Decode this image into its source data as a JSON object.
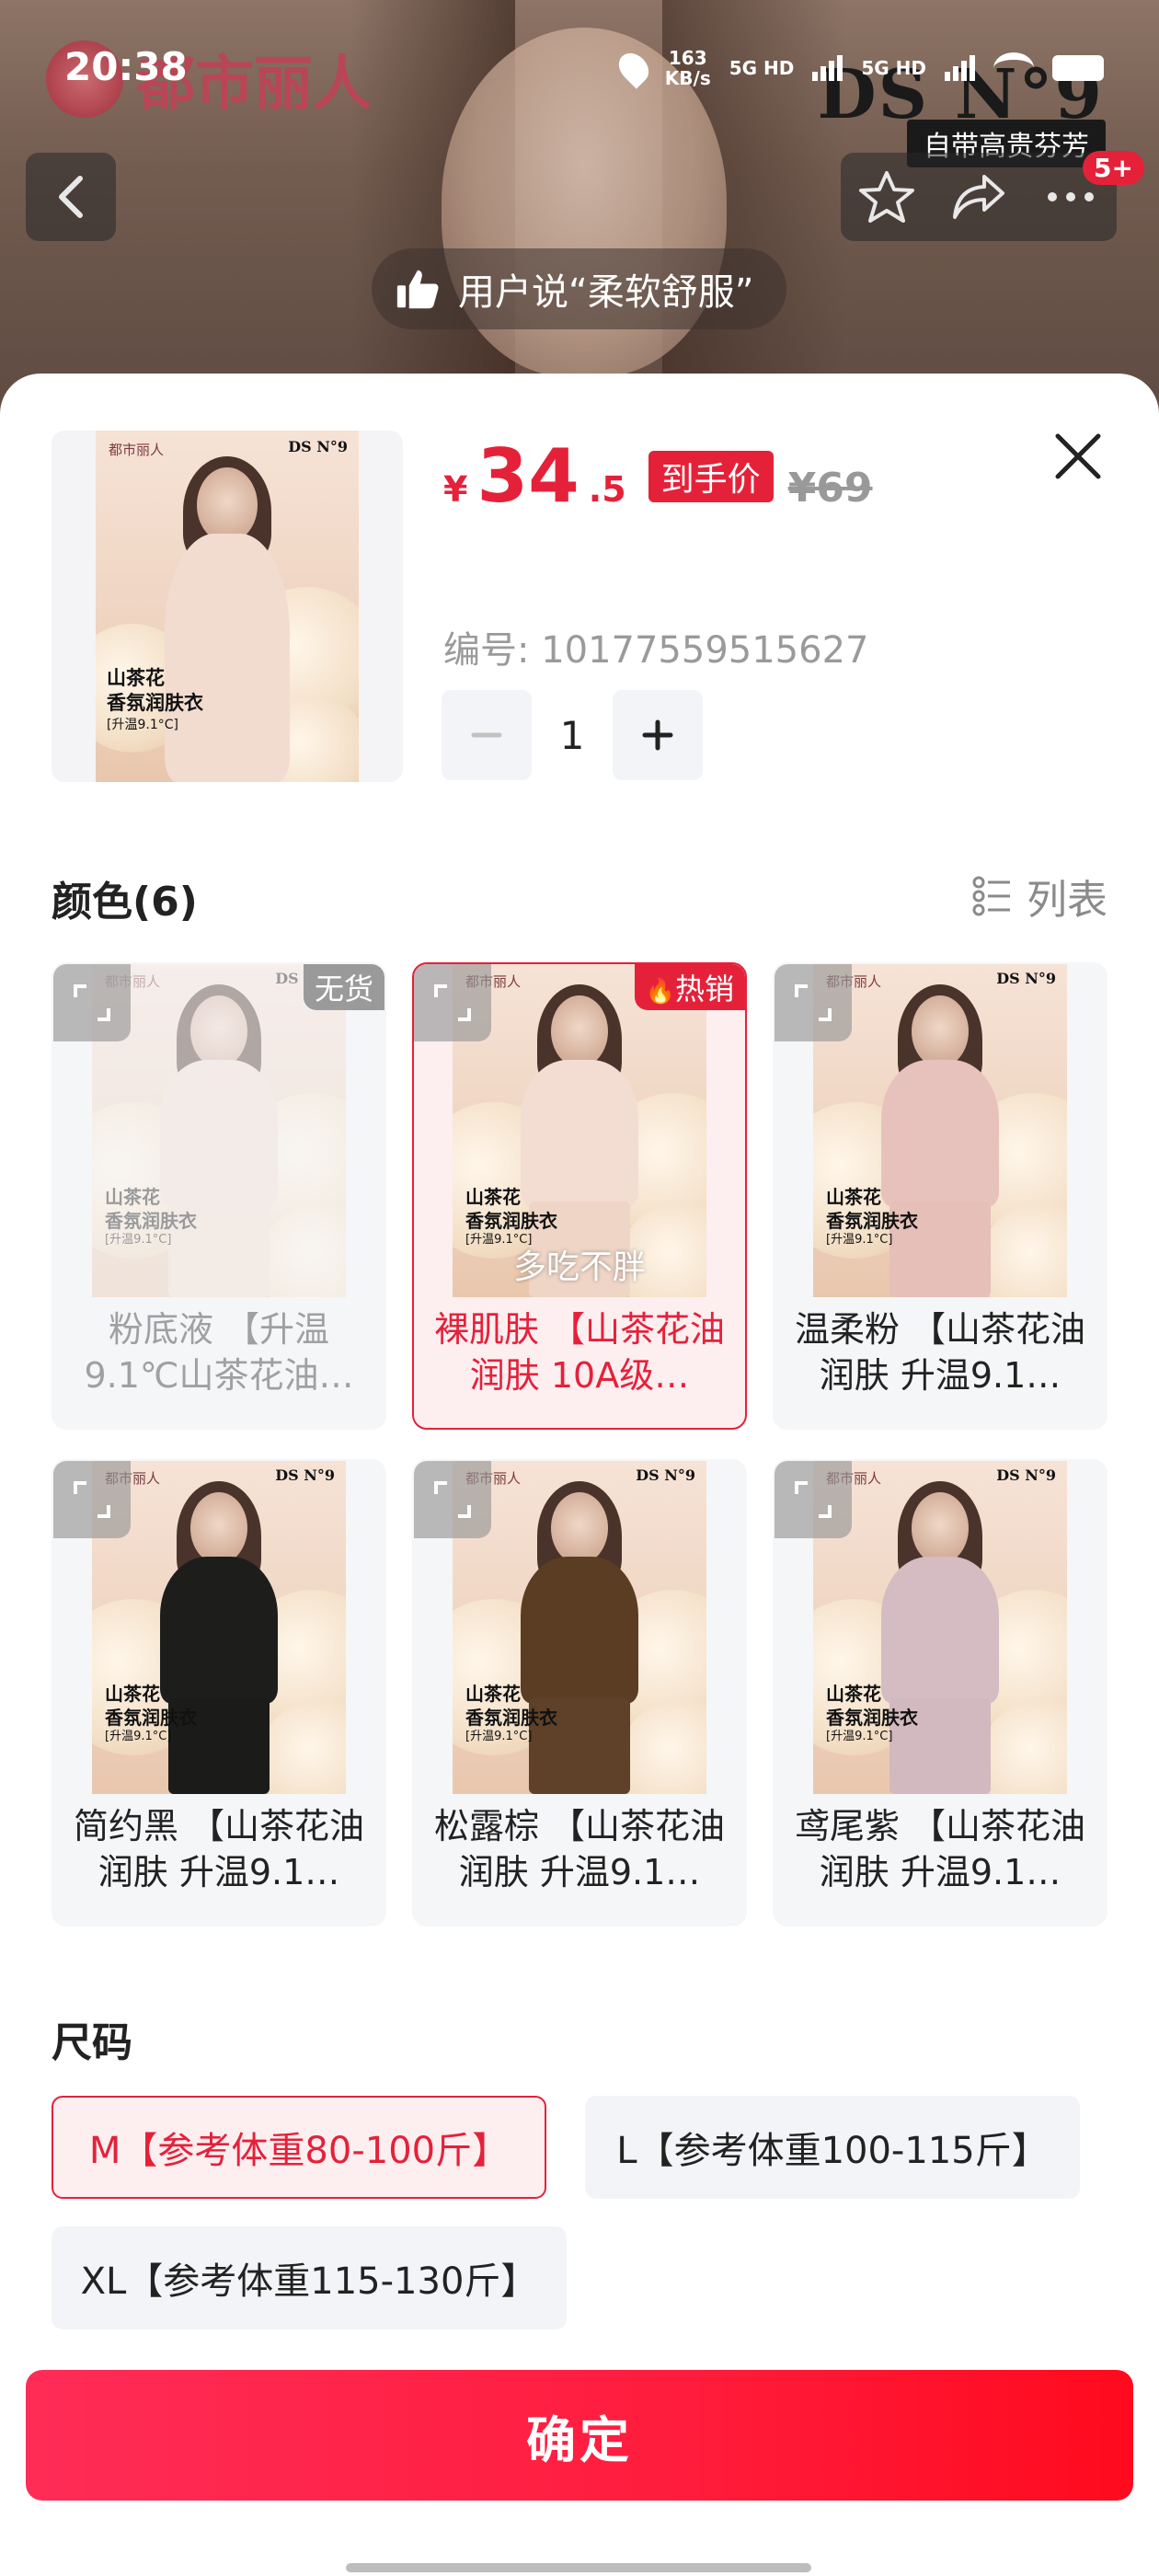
{
  "status_bar": {
    "time": "20:38",
    "net_speed_value": "163",
    "net_speed_unit": "KB/s",
    "signal_1": "5G HD",
    "signal_2": "5G HD"
  },
  "background": {
    "brand_name": "都市丽人",
    "brand_mark": "DS N°9",
    "brand_sub": "自带高贵芬芳"
  },
  "nav": {
    "more_badge": "5+"
  },
  "user_quote": {
    "text": "用户说“柔软舒服”"
  },
  "product": {
    "currency": "¥",
    "price_integer": "34",
    "price_decimal": ".5",
    "price_tag": "到手价",
    "original_price": "¥69",
    "code_label": "编号: 10177559515627",
    "quantity": "1",
    "poster_brand": "都市丽人",
    "poster_ds": "DS N°9",
    "poster_caption_1": "山茶花",
    "poster_caption_2": "香氛润肤衣",
    "poster_caption_3": "[升温9.1°C]"
  },
  "color_section": {
    "title": "颜色(6)",
    "list_toggle_label": "列表",
    "options": [
      {
        "label": "粉底液 【升温9.1℃山茶花油…",
        "badge": "无货",
        "selected": false,
        "soldout": true,
        "shirt_color": "#f1ddd1",
        "pants_color": "#f0dbcd"
      },
      {
        "label": "裸肌肤 【山茶花油润肤 10A级…",
        "badge": "热销",
        "selected": true,
        "soldout": false,
        "overlay": "多吃不胖",
        "shirt_color": "#f3ddd2",
        "pants_color": "#eed5c6"
      },
      {
        "label": "温柔粉 【山茶花油润肤 升温9.1…",
        "badge": "",
        "selected": false,
        "soldout": false,
        "shirt_color": "#e7c2bc",
        "pants_color": "#e5bfb8"
      },
      {
        "label": "简约黑 【山茶花油润肤 升温9.1…",
        "badge": "",
        "selected": false,
        "soldout": false,
        "shirt_color": "#1d1e1c",
        "pants_color": "#1b1c1a"
      },
      {
        "label": "松露棕 【山茶花油润肤 升温9.1…",
        "badge": "",
        "selected": false,
        "soldout": false,
        "shirt_color": "#5b3d24",
        "pants_color": "#5e4128"
      },
      {
        "label": "鸢尾紫 【山茶花油润肤 升温9.1…",
        "badge": "",
        "selected": false,
        "soldout": false,
        "shirt_color": "#d5bcc2",
        "pants_color": "#d2b8bf"
      }
    ]
  },
  "size_section": {
    "title": "尺码",
    "options": [
      {
        "label": "M【参考体重80-100斤】",
        "selected": true
      },
      {
        "label": "L【参考体重100-115斤】",
        "selected": false
      },
      {
        "label": "XL【参考体重115-130斤】",
        "selected": false
      }
    ]
  },
  "confirm_label": "确定"
}
